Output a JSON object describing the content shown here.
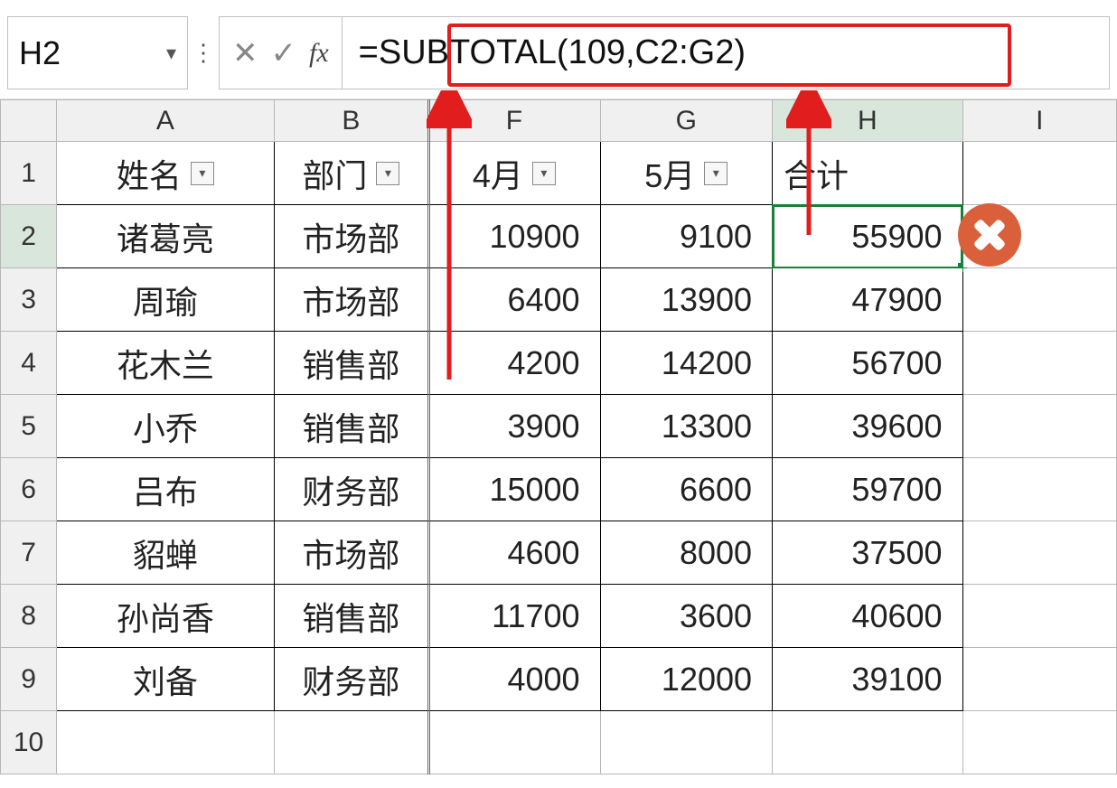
{
  "nameBox": "H2",
  "formula": "=SUBTOTAL(109,C2:G2)",
  "columns": [
    "A",
    "B",
    "F",
    "G",
    "H",
    "I"
  ],
  "selectedColumn": "H",
  "selectedRow": "2",
  "headers": {
    "name": "姓名",
    "dept": "部门",
    "month4": "4月",
    "month5": "5月",
    "total": "合计"
  },
  "rows": [
    {
      "num": "2",
      "name": "诸葛亮",
      "dept": "市场部",
      "m4": "10900",
      "m5": "9100",
      "total": "55900"
    },
    {
      "num": "3",
      "name": "周瑜",
      "dept": "市场部",
      "m4": "6400",
      "m5": "13900",
      "total": "47900"
    },
    {
      "num": "4",
      "name": "花木兰",
      "dept": "销售部",
      "m4": "4200",
      "m5": "14200",
      "total": "56700"
    },
    {
      "num": "5",
      "name": "小乔",
      "dept": "销售部",
      "m4": "3900",
      "m5": "13300",
      "total": "39600"
    },
    {
      "num": "6",
      "name": "吕布",
      "dept": "财务部",
      "m4": "15000",
      "m5": "6600",
      "total": "59700"
    },
    {
      "num": "7",
      "name": "貂蝉",
      "dept": "市场部",
      "m4": "4600",
      "m5": "8000",
      "total": "37500"
    },
    {
      "num": "8",
      "name": "孙尚香",
      "dept": "销售部",
      "m4": "11700",
      "m5": "3600",
      "total": "40600"
    },
    {
      "num": "9",
      "name": "刘备",
      "dept": "财务部",
      "m4": "4000",
      "m5": "12000",
      "total": "39100"
    }
  ],
  "extraRows": [
    "1",
    "10"
  ],
  "annotations": {
    "errorBadge": true
  }
}
